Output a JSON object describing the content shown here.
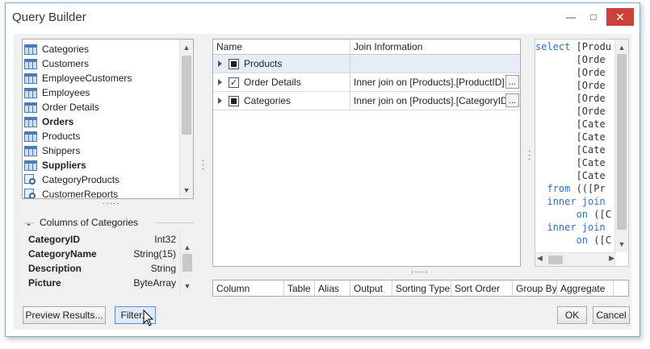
{
  "window": {
    "title": "Query Builder",
    "min_glyph": "—",
    "max_glyph": "□",
    "close_glyph": "✕"
  },
  "tables": {
    "items": [
      {
        "label": "Categories",
        "type": "table",
        "bold": false
      },
      {
        "label": "Customers",
        "type": "table",
        "bold": false
      },
      {
        "label": "EmployeeCustomers",
        "type": "table",
        "bold": false
      },
      {
        "label": "Employees",
        "type": "table",
        "bold": false
      },
      {
        "label": "Order Details",
        "type": "table",
        "bold": false
      },
      {
        "label": "Orders",
        "type": "table",
        "bold": true
      },
      {
        "label": "Products",
        "type": "table",
        "bold": false
      },
      {
        "label": "Shippers",
        "type": "table",
        "bold": false
      },
      {
        "label": "Suppliers",
        "type": "table",
        "bold": true
      },
      {
        "label": "CategoryProducts",
        "type": "view",
        "bold": false
      },
      {
        "label": "CustomerReports",
        "type": "view",
        "bold": false
      }
    ]
  },
  "columns_panel": {
    "header": "Columns of Categories",
    "rows": [
      {
        "name": "CategoryID",
        "type": "Int32"
      },
      {
        "name": "CategoryName",
        "type": "String(15)"
      },
      {
        "name": "Description",
        "type": "String"
      },
      {
        "name": "Picture",
        "type": "ByteArray"
      }
    ]
  },
  "join_grid": {
    "headers": {
      "name": "Name",
      "join": "Join Information"
    },
    "rows": [
      {
        "name": "Products",
        "join": "",
        "check": "indeterminate",
        "selected": true
      },
      {
        "name": "Order Details",
        "join": "Inner join on [Products].[ProductID]",
        "check": "checked",
        "selected": false
      },
      {
        "name": "Categories",
        "join": "Inner join on [Products].[CategoryID]",
        "check": "indeterminate",
        "selected": false
      }
    ],
    "ellipsis": "..."
  },
  "sql": {
    "lines": [
      {
        "kw": "select",
        "rest": " [Produ"
      },
      {
        "kw": "",
        "rest": "       [Orde"
      },
      {
        "kw": "",
        "rest": "       [Orde"
      },
      {
        "kw": "",
        "rest": "       [Orde"
      },
      {
        "kw": "",
        "rest": "       [Orde"
      },
      {
        "kw": "",
        "rest": "       [Orde"
      },
      {
        "kw": "",
        "rest": "       [Cate"
      },
      {
        "kw": "",
        "rest": "       [Cate"
      },
      {
        "kw": "",
        "rest": "       [Cate"
      },
      {
        "kw": "",
        "rest": "       [Cate"
      },
      {
        "kw": "",
        "rest": "       [Cate"
      },
      {
        "kw": "  from",
        "rest": " (([Pr"
      },
      {
        "kw": "  inner join",
        "rest": ""
      },
      {
        "kw": "       on",
        "rest": " ([C"
      },
      {
        "kw": "  inner join",
        "rest": ""
      },
      {
        "kw": "       on",
        "rest": " ([C"
      }
    ]
  },
  "output_grid": {
    "headers": [
      "Column",
      "Table",
      "Alias",
      "Output",
      "Sorting Type",
      "Sort Order",
      "Group By",
      "Aggregate"
    ]
  },
  "buttons": {
    "preview": "Preview Results...",
    "filter": "Filter...",
    "ok": "OK",
    "cancel": "Cancel"
  }
}
